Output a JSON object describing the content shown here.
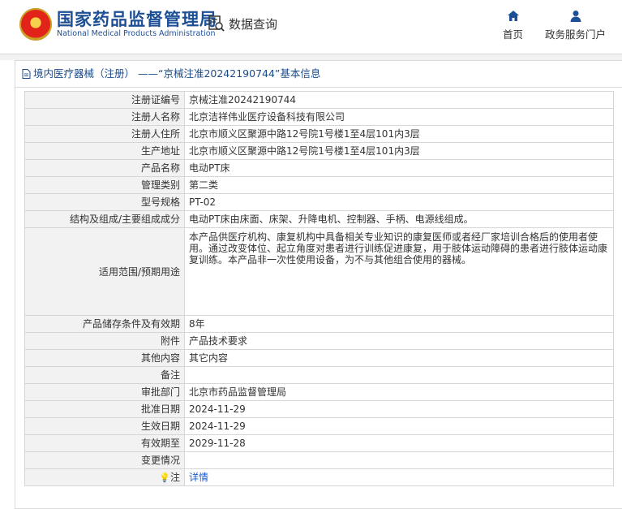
{
  "header": {
    "logo_cn": "国家药品监督管理局",
    "logo_en": "National Medical Products Administration",
    "data_query": "数据查询",
    "nav_home": "首页",
    "nav_portal": "政务服务门户"
  },
  "breadcrumb": "境内医疗器械（注册） ——“京械注准20242190744”基本信息",
  "rows": [
    {
      "label": "注册证编号",
      "value": "京械注准20242190744"
    },
    {
      "label": "注册人名称",
      "value": "北京洁祥伟业医疗设备科技有限公司"
    },
    {
      "label": "注册人住所",
      "value": "北京市顺义区聚源中路12号院1号楼1至4层101内3层"
    },
    {
      "label": "生产地址",
      "value": "北京市顺义区聚源中路12号院1号楼1至4层101内3层"
    },
    {
      "label": "产品名称",
      "value": "电动PT床"
    },
    {
      "label": "管理类别",
      "value": "第二类"
    },
    {
      "label": "型号规格",
      "value": "PT-02"
    },
    {
      "label": "结构及组成/主要组成成分",
      "value": "电动PT床由床面、床架、升降电机、控制器、手柄、电源线组成。"
    },
    {
      "label": "适用范围/预期用途",
      "value": "本产品供医疗机构、康复机构中具备相关专业知识的康复医师或者经厂家培训合格后的使用者使用。通过改变体位、起立角度对患者进行训练促进康复，用于肢体运动障碍的患者进行肢体运动康复训练。本产品非一次性使用设备，为不与其他组合使用的器械。"
    },
    {
      "label": "产品储存条件及有效期",
      "value": "8年"
    },
    {
      "label": "附件",
      "value": "产品技术要求"
    },
    {
      "label": "其他内容",
      "value": "其它内容"
    },
    {
      "label": "备注",
      "value": ""
    },
    {
      "label": "审批部门",
      "value": "北京市药品监督管理局"
    },
    {
      "label": "批准日期",
      "value": "2024-11-29"
    },
    {
      "label": "生效日期",
      "value": "2024-11-29"
    },
    {
      "label": "有效期至",
      "value": "2029-11-28"
    },
    {
      "label": "变更情况",
      "value": ""
    }
  ],
  "note": {
    "label": "注",
    "link": "详情"
  },
  "icons": {
    "emblem": "national-emblem",
    "data_query": "magnifier-doc-icon",
    "home": "house-icon",
    "portal": "person-icon",
    "note": "bulb-icon",
    "crumb": "document-icon"
  },
  "colors": {
    "brand_blue": "#1d4f96",
    "link": "#1a5ccf",
    "label_bg": "#f2f2f2"
  }
}
